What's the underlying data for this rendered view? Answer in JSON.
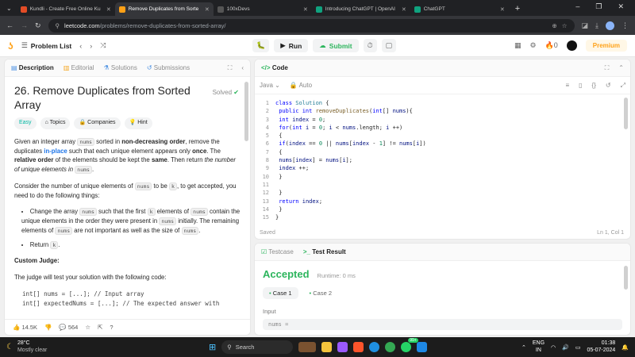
{
  "browser": {
    "tabs": [
      {
        "title": "Kundli - Create Free Online Ku",
        "fav": "#e34c26"
      },
      {
        "title": "Remove Duplicates from Sorte",
        "fav": "#ffa116"
      },
      {
        "title": "100xDevs",
        "fav": "#111111"
      },
      {
        "title": "Introducing ChatGPT | OpenAI",
        "fav": "#10a37f"
      },
      {
        "title": "ChatGPT",
        "fav": "#10a37f"
      }
    ],
    "new_tab": "+",
    "url_host": "leetcode.com",
    "url_path": "/problems/remove-duplicates-from-sorted-array/"
  },
  "lcnav": {
    "problem_list": "Problem List",
    "run": "Run",
    "submit": "Submit",
    "streak": "0",
    "premium": "Premium"
  },
  "left": {
    "tabs": [
      "Description",
      "Editorial",
      "Solutions",
      "Submissions"
    ],
    "title": "26. Remove Duplicates from Sorted Array",
    "solved": "Solved",
    "chips": [
      "Easy",
      "Topics",
      "Companies",
      "Hint"
    ],
    "p1": {
      "a": "Given an integer array ",
      "b": "nums",
      "c": " sorted in ",
      "d": "non-decreasing order",
      "e": ", remove the duplicates ",
      "f": "in-place",
      "g": " such that each unique element appears only ",
      "h": "once",
      "i": ". The ",
      "j": "relative order",
      "k": " of the elements should be kept the ",
      "l": "same",
      "m": ". Then return ",
      "n": "the number of unique elements in ",
      "o": "nums",
      "p": "."
    },
    "p2": {
      "a": "Consider the number of unique elements of ",
      "b": "nums",
      "c": " to be ",
      "d": "k",
      "e": ", to get accepted, you need to do the following things:"
    },
    "li1": {
      "a": "Change the array ",
      "b": "nums",
      "c": " such that the first ",
      "d": "k",
      "e": " elements of ",
      "f": "nums",
      "g": " contain the unique elements in the order they were present in ",
      "h": "nums",
      "i": " initially. The remaining elements of ",
      "j": "nums",
      "k": " are not important as well as the size of ",
      "l": "nums",
      "m": "."
    },
    "li2": {
      "a": "Return ",
      "b": "k",
      "c": "."
    },
    "custom_judge": "Custom Judge:",
    "p3": "The judge will test your solution with the following code:",
    "code1": "int[] nums = [...]; // Input array",
    "code2": "int[] expectedNums = [...]; // The expected answer with",
    "likes": "14.5K",
    "comments": "564"
  },
  "editor": {
    "title": "Code",
    "lang": "Java",
    "mode": "Auto",
    "lines": [
      "class Solution {",
      "    public int removeDuplicates(int[] nums){",
      "        int index = 0;",
      "        for(int i  = 0; i < nums.length; i ++)",
      "        {",
      "            if(index == 0 || nums[index - 1] != nums[i])",
      "            {",
      "                nums[index] = nums[i];",
      "                index ++;",
      "            }",
      "",
      "        }",
      "        return index;",
      "    }",
      "}"
    ],
    "saved": "Saved",
    "cursor": "Ln 1, Col 1"
  },
  "result": {
    "tab1": "Testcase",
    "tab2": "Test Result",
    "status": "Accepted",
    "runtime": "Runtime: 0 ms",
    "case1": "Case 1",
    "case2": "Case 2",
    "input_label": "Input",
    "input_value": "nums ="
  },
  "taskbar": {
    "temp": "28°C",
    "weather": "Mostly clear",
    "search": "Search",
    "lang1": "ENG",
    "lang2": "IN",
    "time": "01:38",
    "date": "05-07-2024",
    "badge": "99+"
  }
}
